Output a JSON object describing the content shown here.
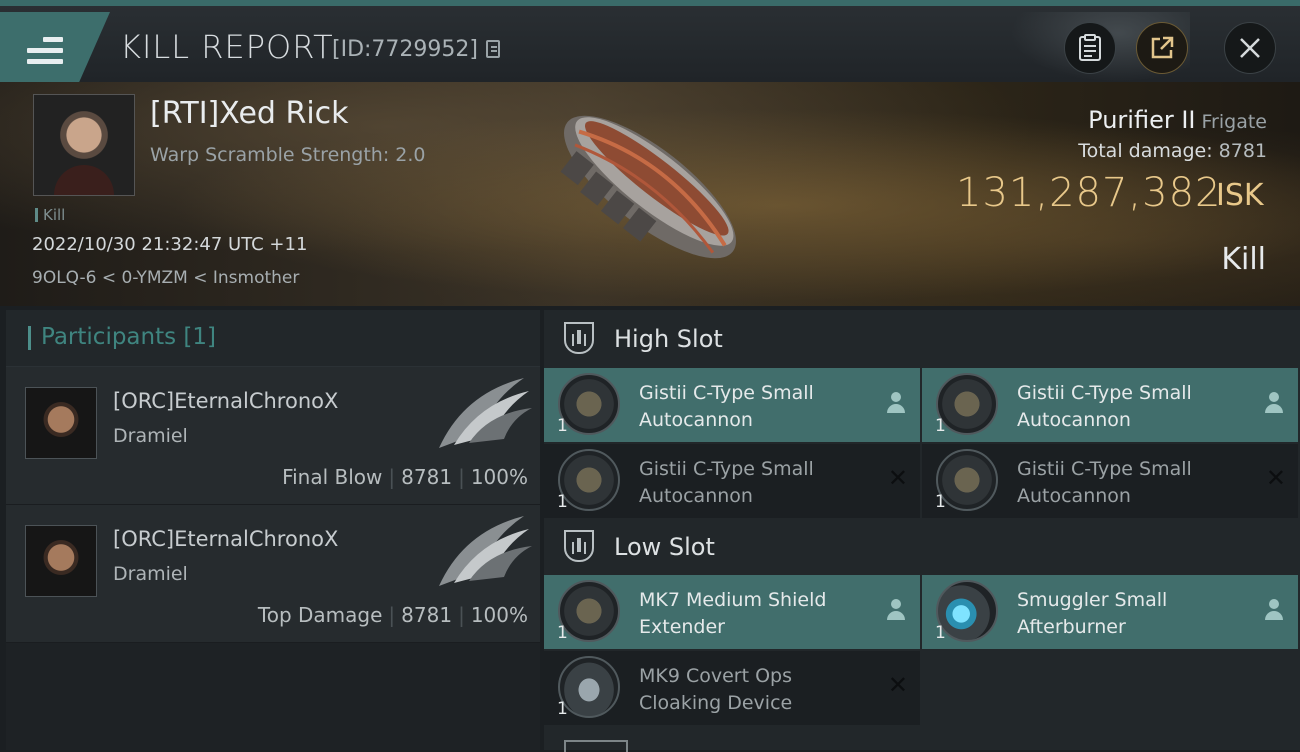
{
  "header": {
    "title": "KILL REPORT",
    "report_id": "[ID:7729952]"
  },
  "victim": {
    "name": "[RTI]Xed Rick",
    "subtitle": "Warp Scramble Strength: 2.0",
    "tag": "Kill",
    "timestamp": "2022/10/30 21:32:47 UTC +11",
    "location": "9OLQ-6 < 0-YMZM < Insmother"
  },
  "ship": {
    "name": "Purifier II",
    "class": "Frigate",
    "total_damage_label": "Total damage:",
    "total_damage": "8781",
    "isk_value": "131,287,382",
    "isk_label": "ISK",
    "result": "Kill"
  },
  "participants": {
    "heading": "Participants [1]",
    "items": [
      {
        "name": "[ORC]EternalChronoX",
        "corp": "Dramiel",
        "label": "Final Blow",
        "damage": "8781",
        "percent": "100%"
      },
      {
        "name": "[ORC]EternalChronoX",
        "corp": "Dramiel",
        "label": "Top Damage",
        "damage": "8781",
        "percent": "100%"
      }
    ]
  },
  "fitting": {
    "high_slot": {
      "label": "High Slot",
      "modules": [
        {
          "qty": "1",
          "name": "Gistii C-Type Small Autocannon",
          "state": "fitted"
        },
        {
          "qty": "1",
          "name": "Gistii C-Type Small Autocannon",
          "state": "fitted"
        },
        {
          "qty": "1",
          "name": "Gistii C-Type Small Autocannon",
          "state": "destroyed"
        },
        {
          "qty": "1",
          "name": "Gistii C-Type Small Autocannon",
          "state": "destroyed"
        }
      ]
    },
    "low_slot": {
      "label": "Low Slot",
      "modules": [
        {
          "qty": "1",
          "name": "MK7 Medium Shield Extender",
          "state": "fitted"
        },
        {
          "qty": "1",
          "name": "Smuggler Small Afterburner",
          "state": "fitted"
        },
        {
          "qty": "1",
          "name": "MK9 Covert Ops Cloaking Device",
          "state": "destroyed"
        }
      ]
    }
  },
  "colors": {
    "accent": "#416e6c",
    "isk": "#e8c88a",
    "participants_heading": "#3f8580"
  }
}
